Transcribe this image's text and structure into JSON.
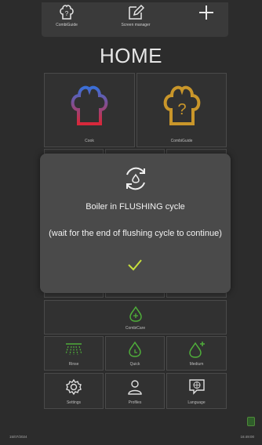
{
  "toolbar": {
    "combiguide_label": "CombiGuide",
    "screen_manager_label": "Screen manager"
  },
  "page": {
    "title": "HOME"
  },
  "tiles": {
    "cook": "Cook",
    "combiguide": "CombiGuide",
    "combicare": "CombiCare",
    "rinse": "Rinse",
    "quick": "Quick",
    "medium": "Medium",
    "settings": "Settings",
    "profiles": "Profiles",
    "language": "Language"
  },
  "modal": {
    "title": "Boiler in FLUSHING cycle",
    "message": "(wait for the end of flushing cycle to continue)"
  },
  "footer": {
    "date": "15/07/2024",
    "time": "16:49:00"
  },
  "colors": {
    "accent_green": "#4fae3a",
    "confirm_yellow": "#c8e03c",
    "chef_gold": "#c9962a"
  }
}
